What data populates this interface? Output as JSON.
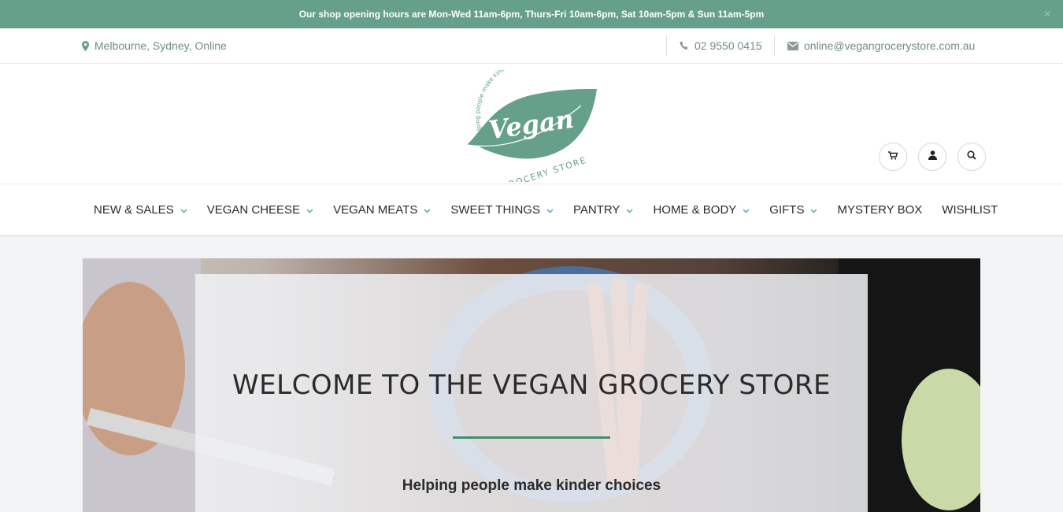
{
  "announcement": {
    "text": "Our shop opening hours are Mon-Wed 11am-6pm, Thurs-Fri 10am-6pm, Sat 10am-5pm & Sun 11am-5pm",
    "close_label": "×"
  },
  "contact": {
    "location": "Melbourne, Sydney, Online",
    "phone": "02 9550 0415",
    "email": "online@vegangrocerystore.com.au"
  },
  "logo": {
    "arc_text": "Helping people make kinder choices",
    "word": "Vegan",
    "sub_text": "GROCERY STORE"
  },
  "header_buttons": [
    "cart-icon",
    "user-icon",
    "search-icon"
  ],
  "nav": {
    "items": [
      {
        "label": "NEW & SALES",
        "dropdown": true
      },
      {
        "label": "VEGAN CHEESE",
        "dropdown": true
      },
      {
        "label": "VEGAN MEATS",
        "dropdown": true
      },
      {
        "label": "SWEET THINGS",
        "dropdown": true
      },
      {
        "label": "PANTRY",
        "dropdown": true
      },
      {
        "label": "HOME & BODY",
        "dropdown": true
      },
      {
        "label": "GIFTS",
        "dropdown": true
      },
      {
        "label": "MYSTERY BOX",
        "dropdown": false
      },
      {
        "label": "WISHLIST",
        "dropdown": false
      }
    ]
  },
  "hero": {
    "title": "WELCOME TO THE VEGAN GROCERY STORE",
    "tagline": "Helping people make kinder choices"
  },
  "colors": {
    "brand_green": "#67a08a",
    "accent_rule": "#3f8f66",
    "chevron": "#5aa7b8"
  }
}
